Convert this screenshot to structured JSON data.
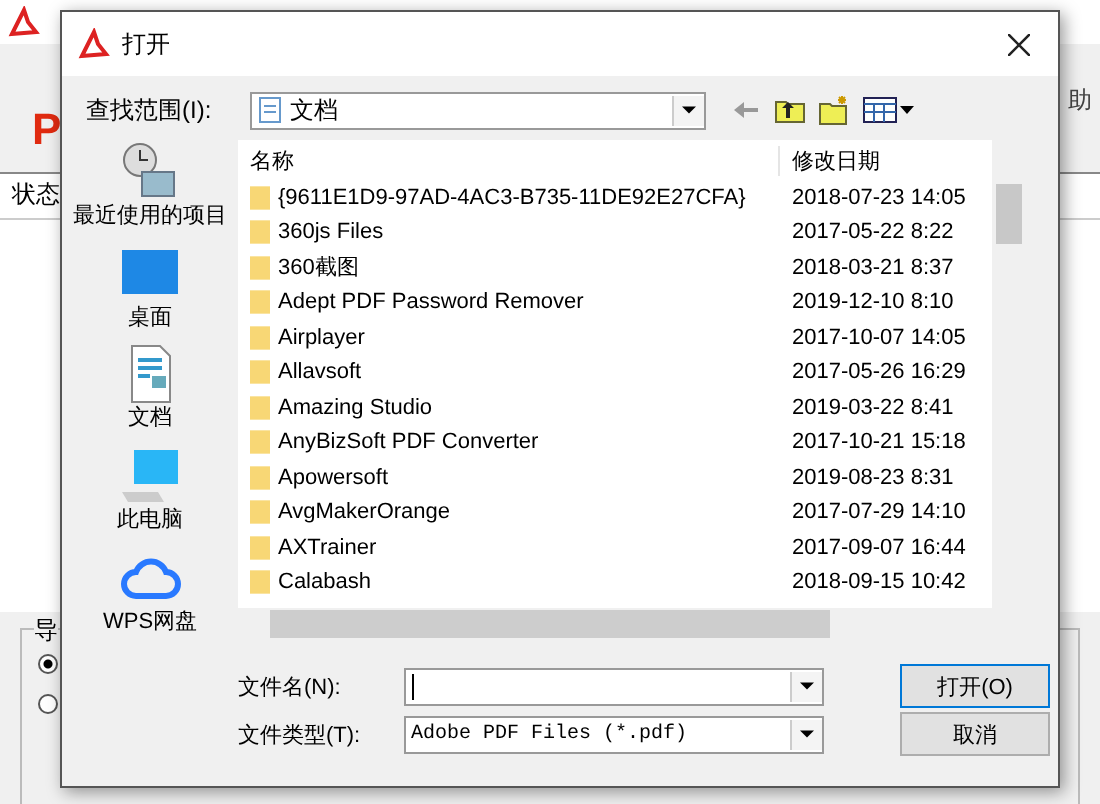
{
  "background_app": {
    "heading": "P",
    "menu_item": "助",
    "column": "状态",
    "group_label": "导",
    "radios": [
      {
        "selected": true
      },
      {
        "selected": false
      }
    ]
  },
  "dialog": {
    "title": "打开",
    "look_in": {
      "label": "查找范围(I):",
      "value": "文档"
    },
    "places": [
      {
        "kind": "recent",
        "label": "最近使用的项目"
      },
      {
        "kind": "desktop",
        "label": "桌面"
      },
      {
        "kind": "documents",
        "label": "文档"
      },
      {
        "kind": "computer",
        "label": "此电脑"
      },
      {
        "kind": "cloud",
        "label": "WPS网盘"
      }
    ],
    "columns": [
      "名称",
      "修改日期"
    ],
    "files": [
      {
        "name": "{9611E1D9-97AD-4AC3-B735-11DE92E27CFA}",
        "date": "2018-07-23 14:05"
      },
      {
        "name": "360js Files",
        "date": "2017-05-22 8:22"
      },
      {
        "name": "360截图",
        "date": "2018-03-21 8:37"
      },
      {
        "name": "Adept PDF Password Remover",
        "date": "2019-12-10 8:10"
      },
      {
        "name": "Airplayer",
        "date": "2017-10-07 14:05"
      },
      {
        "name": "Allavsoft",
        "date": "2017-05-26 16:29"
      },
      {
        "name": "Amazing Studio",
        "date": "2019-03-22 8:41"
      },
      {
        "name": "AnyBizSoft PDF Converter",
        "date": "2017-10-21 15:18"
      },
      {
        "name": "Apowersoft",
        "date": "2019-08-23 8:31"
      },
      {
        "name": "AvgMakerOrange",
        "date": "2017-07-29 14:10"
      },
      {
        "name": "AXTrainer",
        "date": "2017-09-07 16:44"
      },
      {
        "name": "Calabash",
        "date": "2018-09-15 10:42"
      }
    ],
    "file_name": {
      "label": "文件名(N):"
    },
    "file_type": {
      "label": "文件类型(T):",
      "value": "Adobe PDF Files (*.pdf)"
    },
    "buttons": [
      "打开(O)",
      "取消"
    ]
  }
}
